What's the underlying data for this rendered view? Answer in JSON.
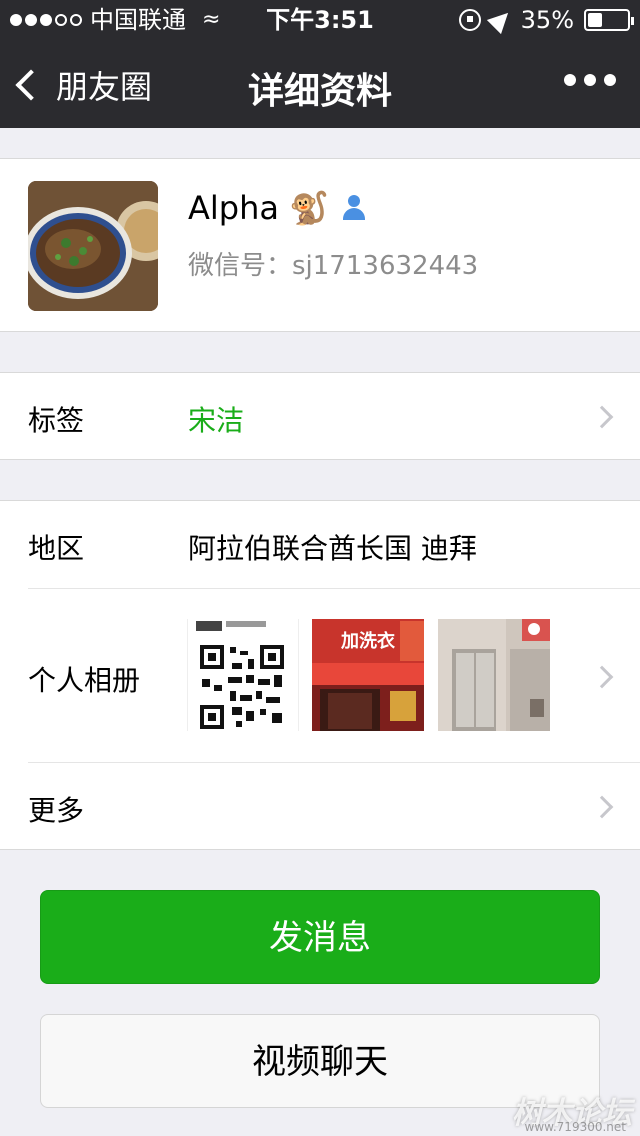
{
  "status_bar": {
    "carrier": "中国联通",
    "time": "下午3:51",
    "battery": "35%",
    "battery_level": 0.35
  },
  "nav": {
    "back_label": "朋友圈",
    "title": "详细资料"
  },
  "profile": {
    "name": "Alpha",
    "emoji": "🐒",
    "wechat_id": "微信号：sj1713632443"
  },
  "tags": {
    "label": "标签",
    "value": "宋洁"
  },
  "region": {
    "label": "地区",
    "value": "阿拉伯联合酋长国 迪拜"
  },
  "album": {
    "label": "个人相册",
    "thumb2_text": "加洗衣"
  },
  "more": {
    "label": "更多"
  },
  "actions": {
    "message": "发消息",
    "video_call": "视频聊天"
  },
  "watermark": {
    "text": "树木论坛",
    "url": "www.719300.net"
  },
  "colors": {
    "nav_bg": "#2b2b2f",
    "accent_green": "#1aad19",
    "page_bg": "#efeff4"
  }
}
